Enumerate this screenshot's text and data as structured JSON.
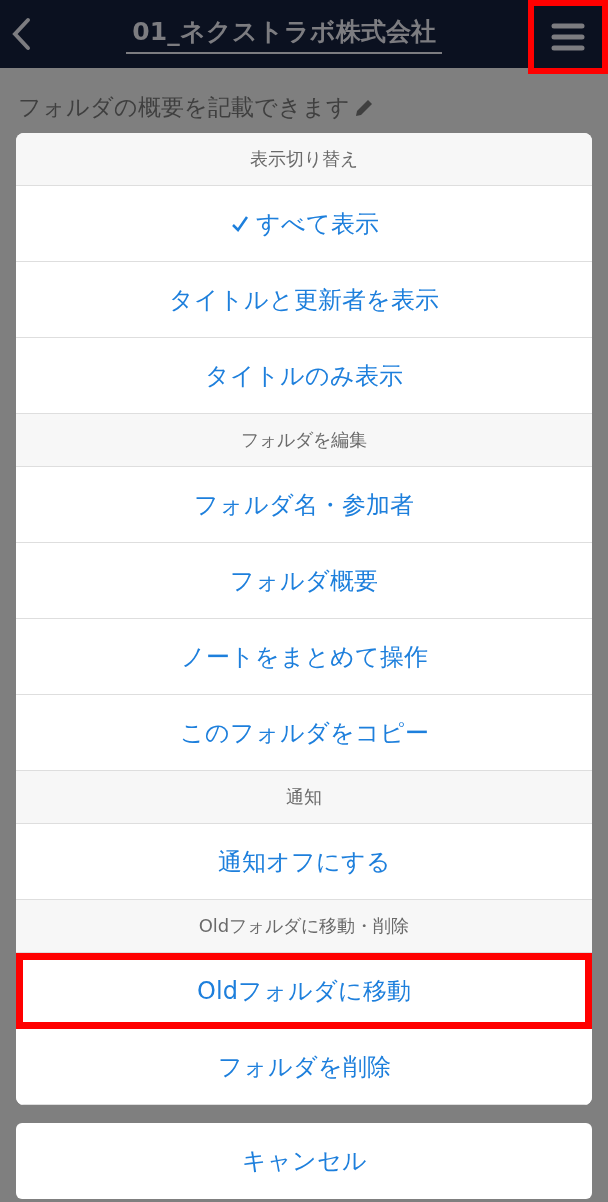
{
  "header": {
    "title": "01_ネクストラボ株式会社",
    "menu_highlighted": true
  },
  "description": "フォルダの概要を記載できます",
  "action_sheet": {
    "sections": [
      {
        "heading": "表示切り替え",
        "items": [
          {
            "label": "すべて表示",
            "checked": true,
            "highlighted": false
          },
          {
            "label": "タイトルと更新者を表示",
            "checked": false,
            "highlighted": false
          },
          {
            "label": "タイトルのみ表示",
            "checked": false,
            "highlighted": false
          }
        ]
      },
      {
        "heading": "フォルダを編集",
        "items": [
          {
            "label": "フォルダ名・参加者",
            "checked": false,
            "highlighted": false
          },
          {
            "label": "フォルダ概要",
            "checked": false,
            "highlighted": false
          },
          {
            "label": "ノートをまとめて操作",
            "checked": false,
            "highlighted": false
          },
          {
            "label": "このフォルダをコピー",
            "checked": false,
            "highlighted": false
          }
        ]
      },
      {
        "heading": "通知",
        "items": [
          {
            "label": "通知オフにする",
            "checked": false,
            "highlighted": false
          }
        ]
      },
      {
        "heading": "Oldフォルダに移動・削除",
        "items": [
          {
            "label": "Oldフォルダに移動",
            "checked": false,
            "highlighted": true
          },
          {
            "label": "フォルダを削除",
            "checked": false,
            "highlighted": false
          }
        ]
      }
    ],
    "cancel": "キャンセル"
  }
}
